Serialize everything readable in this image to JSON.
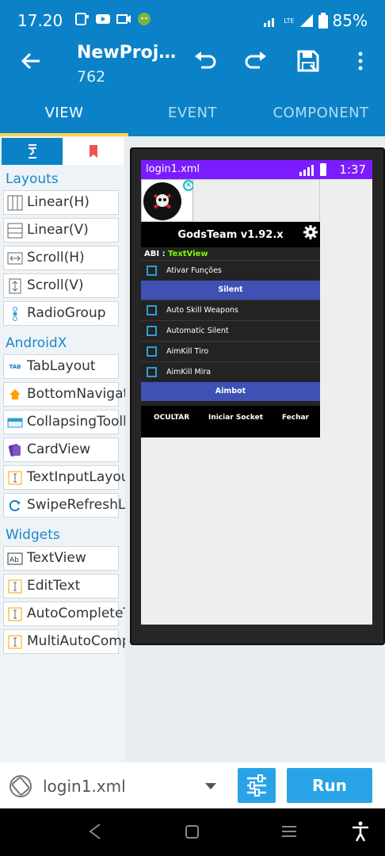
{
  "status_bar": {
    "time": "17.20",
    "battery": "85%",
    "network": "LTE"
  },
  "app_bar": {
    "title": "NewProj…",
    "subtitle": "762"
  },
  "tabs": [
    {
      "label": "VIEW"
    },
    {
      "label": "EVENT"
    },
    {
      "label": "COMPONENT"
    }
  ],
  "palette": {
    "sections": [
      {
        "title": "Layouts",
        "items": [
          "Linear(H)",
          "Linear(V)",
          "Scroll(H)",
          "Scroll(V)",
          "RadioGroup"
        ]
      },
      {
        "title": "AndroidX",
        "items": [
          "TabLayout",
          "BottomNavigationView",
          "CollapsingToolbar",
          "CardView",
          "TextInputLayout",
          "SwipeRefreshLayout"
        ]
      },
      {
        "title": "Widgets",
        "items": [
          "TextView",
          "EditText",
          "AutoCompleteTextView",
          "MultiAutoCompleteTextView"
        ]
      }
    ]
  },
  "device": {
    "file_name": "login1.xml",
    "time": "1:37",
    "panel_title": "GodsTeam v1.92.x",
    "abi_label": "ABI : ",
    "abi_value": "TextView",
    "check_top": "Ativar Funções",
    "silent_button": "Silent",
    "checks_mid": [
      "Auto Skill Weapons",
      "Automatic Silent",
      "AimKill Tiro",
      "AimKill Mira"
    ],
    "aimbot_button": "Aimbot",
    "bottom_buttons": [
      "OCULTAR",
      "Iniciar Socket",
      "Fechar"
    ]
  },
  "bottom_bar": {
    "file": "login1.xml",
    "run_label": "Run"
  },
  "colors": {
    "primary": "#0b82c8",
    "accent": "#ffd54f",
    "device_bar": "#7b1cff",
    "button_blue": "#3f51b5",
    "run": "#29a3e8"
  }
}
